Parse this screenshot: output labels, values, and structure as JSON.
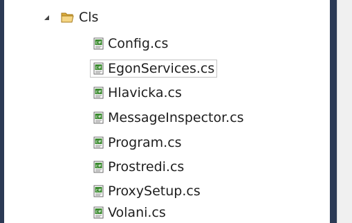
{
  "tree": {
    "folder": {
      "label": "Cls",
      "expanded": true,
      "icon": "folder-open-icon"
    },
    "files": [
      {
        "label": "Config.cs",
        "icon": "csharp-file-icon",
        "selected": false
      },
      {
        "label": "EgonServices.cs",
        "icon": "csharp-file-icon",
        "selected": true
      },
      {
        "label": "Hlavicka.cs",
        "icon": "csharp-file-icon",
        "selected": false
      },
      {
        "label": "MessageInspector.cs",
        "icon": "csharp-file-icon",
        "selected": false
      },
      {
        "label": "Program.cs",
        "icon": "csharp-file-icon",
        "selected": false
      },
      {
        "label": "Prostredi.cs",
        "icon": "csharp-file-icon",
        "selected": false
      },
      {
        "label": "ProxySetup.cs",
        "icon": "csharp-file-icon",
        "selected": false
      },
      {
        "label": "Volani.cs",
        "icon": "csharp-file-icon",
        "selected": false
      }
    ]
  },
  "colors": {
    "frame": "#2b3a55",
    "text": "#1e1e1e",
    "folder": "#e8c468",
    "icon_green": "#3a8a2e"
  }
}
